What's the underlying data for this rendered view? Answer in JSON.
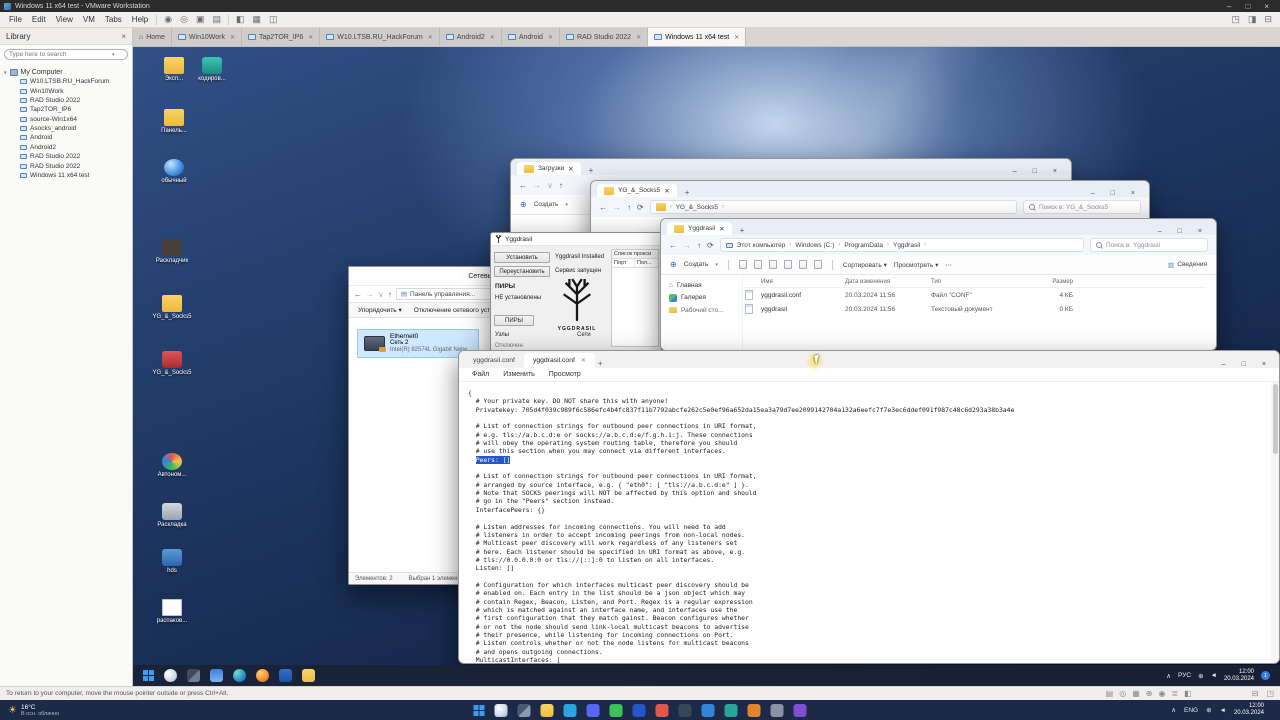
{
  "vmware": {
    "window_title": "Windows 11 x64 test - VMware Workstation",
    "menu": [
      "File",
      "Edit",
      "View",
      "VM",
      "Tabs",
      "Help"
    ],
    "tabs": [
      "Home",
      "Win10Work",
      "Tap2TOR_IP6",
      "W10.LTSB.RU_HackForum",
      "Android2",
      "Android",
      "RAD Studio 2022",
      "Windows 11 x64 test"
    ],
    "status_message": "To return to your computer, move the mouse pointer outside or press Ctrl+Alt.",
    "library": {
      "title": "Library",
      "search_placeholder": "Type here to search",
      "root": "My Computer",
      "items": [
        "W10.LTSB.RU_HackForum",
        "Win10Work",
        "RAD Studio 2022",
        "Tap2TOR_IP6",
        "source-Win1x64",
        "Asocks_android",
        "Android",
        "Android2",
        "RAD Studio 2022",
        "RAD Studio 2022",
        "Windows 11 x64 test"
      ]
    }
  },
  "desktop": {
    "icons": [
      {
        "label": "Эксп..."
      },
      {
        "label": "кодиров..."
      },
      {
        "label": "Панель..."
      },
      {
        "label": "обычный"
      },
      {
        "label": "Раскладчик"
      },
      {
        "label": "YG_&_Socks5"
      },
      {
        "label": "YG_&_Socks5"
      },
      {
        "label": "Автоном..."
      },
      {
        "label": "Раскладка"
      },
      {
        "label": "hds"
      },
      {
        "label": "распаков..."
      }
    ]
  },
  "downloads_win": {
    "title": "Загрузки",
    "new_button": "Создать"
  },
  "ygsocks_win": {
    "title": "YG_&_Socks5",
    "breadcrumb": "YG_&_Socks5",
    "search": "Поиск в: YG_&_Socks5"
  },
  "installer_win": {
    "title": "Yggdrasil",
    "install_button": "Установить",
    "installed_status": "Yggdrasil Installed",
    "reinstall_button": "Переустановить",
    "service_status": "Сервис запущен",
    "peers_header": "ПИРЫ",
    "peers_status": "НЕ установлены",
    "peers_button": "ПИРЫ",
    "nodes_label": "Узлы",
    "networks_label": "Сети",
    "connection_status": "Отключен",
    "logo_text": "YGGDRASIL",
    "proxy_title": "Список прокси",
    "proxy_col_port": "Порт",
    "proxy_col_2": "Пол..."
  },
  "network_win": {
    "title": "Сетевые подключения",
    "breadcrumb": "Панель управления...",
    "organize_button": "Упорядочить",
    "disable_button": "Отключение сетевого устро...",
    "adapter_name": "Ethernet0",
    "adapter_network": "Сеть 2",
    "adapter_device": "Intel(R) 82574L Gigabit Netw...",
    "status_items": "Элементов: 2",
    "status_selected": "Выбран 1 элемент"
  },
  "explorer_win": {
    "tab_title": "Yggdrasil",
    "crumbs": [
      "Этот компьютер",
      "Windows (C:)",
      "ProgramData",
      "Yggdrasil"
    ],
    "search": "Поиск в: Yggdrasil",
    "new_button": "Создать",
    "sort_button": "Сортировать",
    "view_button": "Просмотреть",
    "more_button": "⋯",
    "details_button": "Сведения",
    "nav_items": [
      "Главная",
      "Галерея",
      "Рабочий сто..."
    ],
    "columns": [
      "Имя",
      "Дата изменения",
      "Тип",
      "Размер"
    ],
    "files": [
      {
        "name": "yggdrasil.conf",
        "date": "20.03.2024 11:56",
        "type": "Файл \"CONF\"",
        "size": "4 КБ"
      },
      {
        "name": "yggdrasil",
        "date": "20.03.2024 11:56",
        "type": "Текстовый документ",
        "size": "0 КБ"
      }
    ]
  },
  "notepad": {
    "tabs": [
      "yggdrasil.conf",
      "yggdrasil.conf"
    ],
    "menu": [
      "Файл",
      "Изменить",
      "Просмотр"
    ],
    "highlight_line": 8,
    "lines": [
      "{",
      "  # Your private key. DO NOT share this with anyone!",
      "  Privatekey: 705d4f039c989f6c586efc4b4fc837f11b7792abcfe262c5e0ef96a652da15ea3a79d7ee2099142704a132a6eefc7f7e3ec6ddef091f987c48c6d293a38b3a4e",
      "",
      "  # List of connection strings for outbound peer connections in URI format,",
      "  # e.g. tls://a.b.c.d:e or socks://a.b.c.d:e/f.g.h.i:j. These connections",
      "  # will obey the operating system routing table, therefore you should",
      "  # use this section when you may connect via different interfaces.",
      "  Peers: []",
      "",
      "  # List of connection strings for outbound peer connections in URI format,",
      "  # arranged by source interface, e.g. { \"eth0\": [ \"tls://a.b.c.d:e\" ] }.",
      "  # Note that SOCKS peerings will NOT be affected by this option and should",
      "  # go in the \"Peers\" section instead.",
      "  InterfacePeers: {}",
      "",
      "  # Listen addresses for incoming connections. You will need to add",
      "  # listeners in order to accept incoming peerings from non-local nodes.",
      "  # Multicast peer discovery will work regardless of any listeners set",
      "  # here. Each listener should be specified in URI format as above, e.g.",
      "  # tls://0.0.0.0:0 or tls://[::]:0 to listen on all interfaces.",
      "  Listen: []",
      "",
      "  # Configuration for which interfaces multicast peer discovery should be",
      "  # enabled on. Each entry in the list should be a json object which may",
      "  # contain Regex, Beacon, Listen, and Port. Regex is a regular expression",
      "  # which is matched against an interface name, and interfaces use the",
      "  # first configuration that they match gainst. Beacon configures whether",
      "  # or not the node should send link-local multicast beacons to advertise",
      "  # their presence, while listening for incoming connections on Port.",
      "  # Listen controls whether or not the node listens for multicast beacons",
      "  # and opens outgoing connections.",
      "  MulticastInterfaces: ["
    ]
  },
  "vm_taskbar": {
    "lang": "РУС",
    "time": "12:00",
    "date": "20.03.2024",
    "badge": "1"
  },
  "host_taskbar": {
    "weather_temp": "16°C",
    "weather_desc": "В осн. облачно",
    "lang": "ENG",
    "time": "12:00",
    "date": "20.03.2024"
  }
}
